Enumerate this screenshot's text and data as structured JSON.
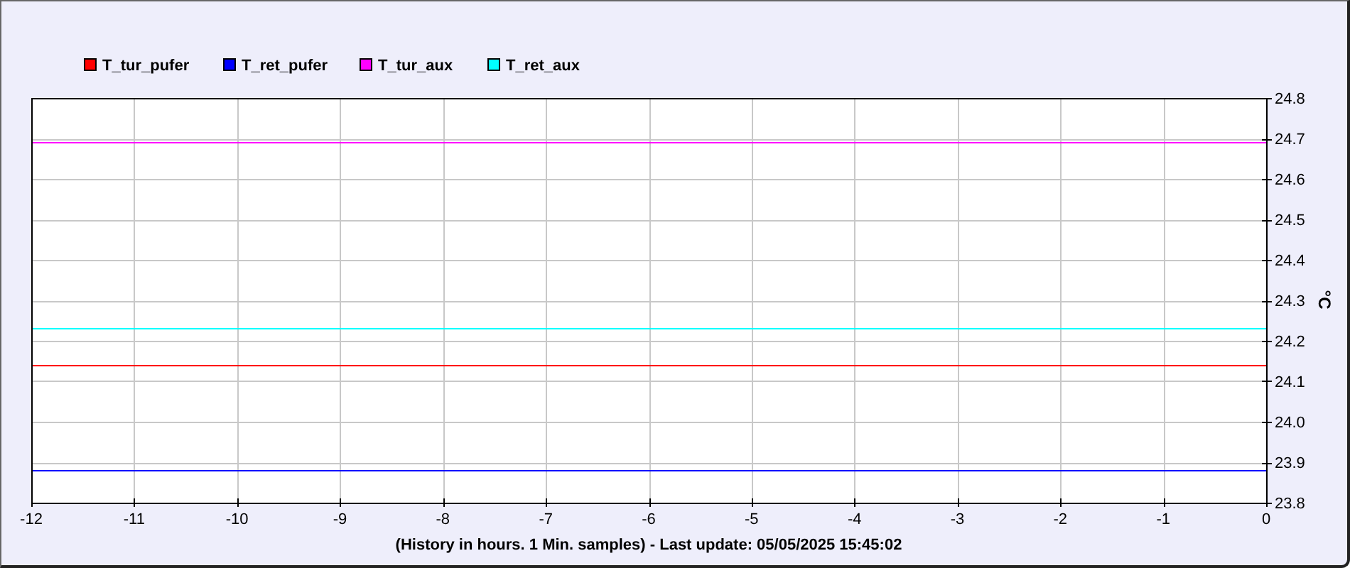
{
  "chart_data": {
    "type": "line",
    "xlabel": "(History in hours. 1 Min. samples) - Last update: 05/05/2025 15:45:02",
    "ylabel": "°C",
    "x": [
      -12,
      0
    ],
    "series": [
      {
        "name": "T_tur_pufer",
        "color": "#ff0000",
        "values": [
          24.14,
          24.14
        ]
      },
      {
        "name": "T_ret_pufer",
        "color": "#0000ff",
        "values": [
          23.88,
          23.88
        ]
      },
      {
        "name": "T_tur_aux",
        "color": "#ff00ff",
        "values": [
          24.69,
          24.69
        ]
      },
      {
        "name": "T_ret_aux",
        "color": "#00ffff",
        "values": [
          24.23,
          24.23
        ]
      }
    ],
    "grid": true,
    "legend": true,
    "xlim": [
      -12,
      0
    ],
    "ylim": [
      23.8,
      24.8
    ],
    "xticks": [
      -12,
      -11,
      -10,
      -9,
      -8,
      -7,
      -6,
      -5,
      -4,
      -3,
      -2,
      -1,
      0
    ],
    "yticks": [
      {
        "value": 23.8,
        "label": "23.8"
      },
      {
        "value": 23.9,
        "label": "23.9"
      },
      {
        "value": 24.0,
        "label": "24.0"
      },
      {
        "value": 24.1,
        "label": "24.1"
      },
      {
        "value": 24.2,
        "label": "24.2"
      },
      {
        "value": 24.3,
        "label": "24.3"
      },
      {
        "value": 24.4,
        "label": "24.4"
      },
      {
        "value": 24.5,
        "label": "24.5"
      },
      {
        "value": 24.6,
        "label": "24.6"
      },
      {
        "value": 24.7,
        "label": "24.7"
      },
      {
        "value": 24.8,
        "label": "24.8"
      }
    ]
  }
}
